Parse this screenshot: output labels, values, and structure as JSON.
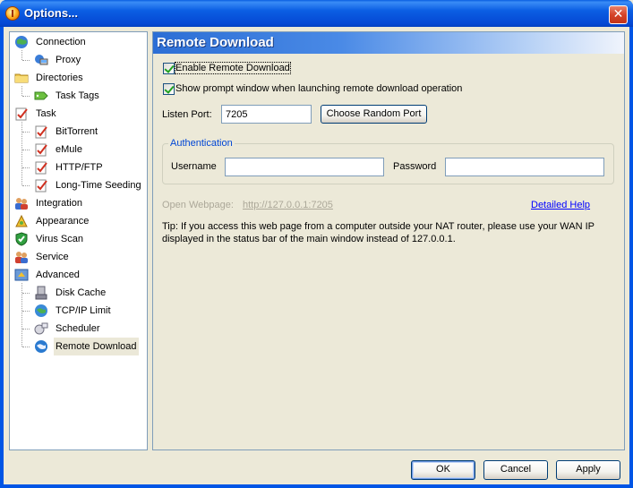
{
  "window": {
    "title": "Options..."
  },
  "tree": {
    "items": [
      {
        "label": "Connection"
      },
      {
        "label": "Proxy"
      },
      {
        "label": "Directories"
      },
      {
        "label": "Task Tags"
      },
      {
        "label": "Task"
      },
      {
        "label": "BitTorrent"
      },
      {
        "label": "eMule"
      },
      {
        "label": "HTTP/FTP"
      },
      {
        "label": "Long-Time Seeding"
      },
      {
        "label": "Integration"
      },
      {
        "label": "Appearance"
      },
      {
        "label": "Virus Scan"
      },
      {
        "label": "Service"
      },
      {
        "label": "Advanced"
      },
      {
        "label": "Disk Cache"
      },
      {
        "label": "TCP/IP Limit"
      },
      {
        "label": "Scheduler"
      },
      {
        "label": "Remote Download"
      }
    ],
    "selected": "Remote Download"
  },
  "panel": {
    "title": "Remote Download",
    "enable_remote_download": "Enable Remote Download",
    "show_prompt": "Show prompt window when launching remote download operation",
    "listen_port_label": "Listen Port:",
    "listen_port_value": "7205",
    "choose_random_port": "Choose Random Port",
    "auth": {
      "title": "Authentication",
      "username_label": "Username",
      "username_value": "",
      "password_label": "Password",
      "password_value": ""
    },
    "open_webpage_label": "Open Webpage:",
    "open_webpage_url": "http://127.0.0.1:7205",
    "detailed_help": "Detailed Help",
    "tip": "Tip: If you access this web page from a computer outside your NAT router, please use your WAN IP displayed in the status bar of the main window instead of 127.0.0.1."
  },
  "buttons": {
    "ok": "OK",
    "cancel": "Cancel",
    "apply": "Apply"
  },
  "colors": {
    "title_bar": "#0055e5",
    "panel_header": "#2c6ed5",
    "link": "#0000ff",
    "group_title": "#0046d5"
  }
}
